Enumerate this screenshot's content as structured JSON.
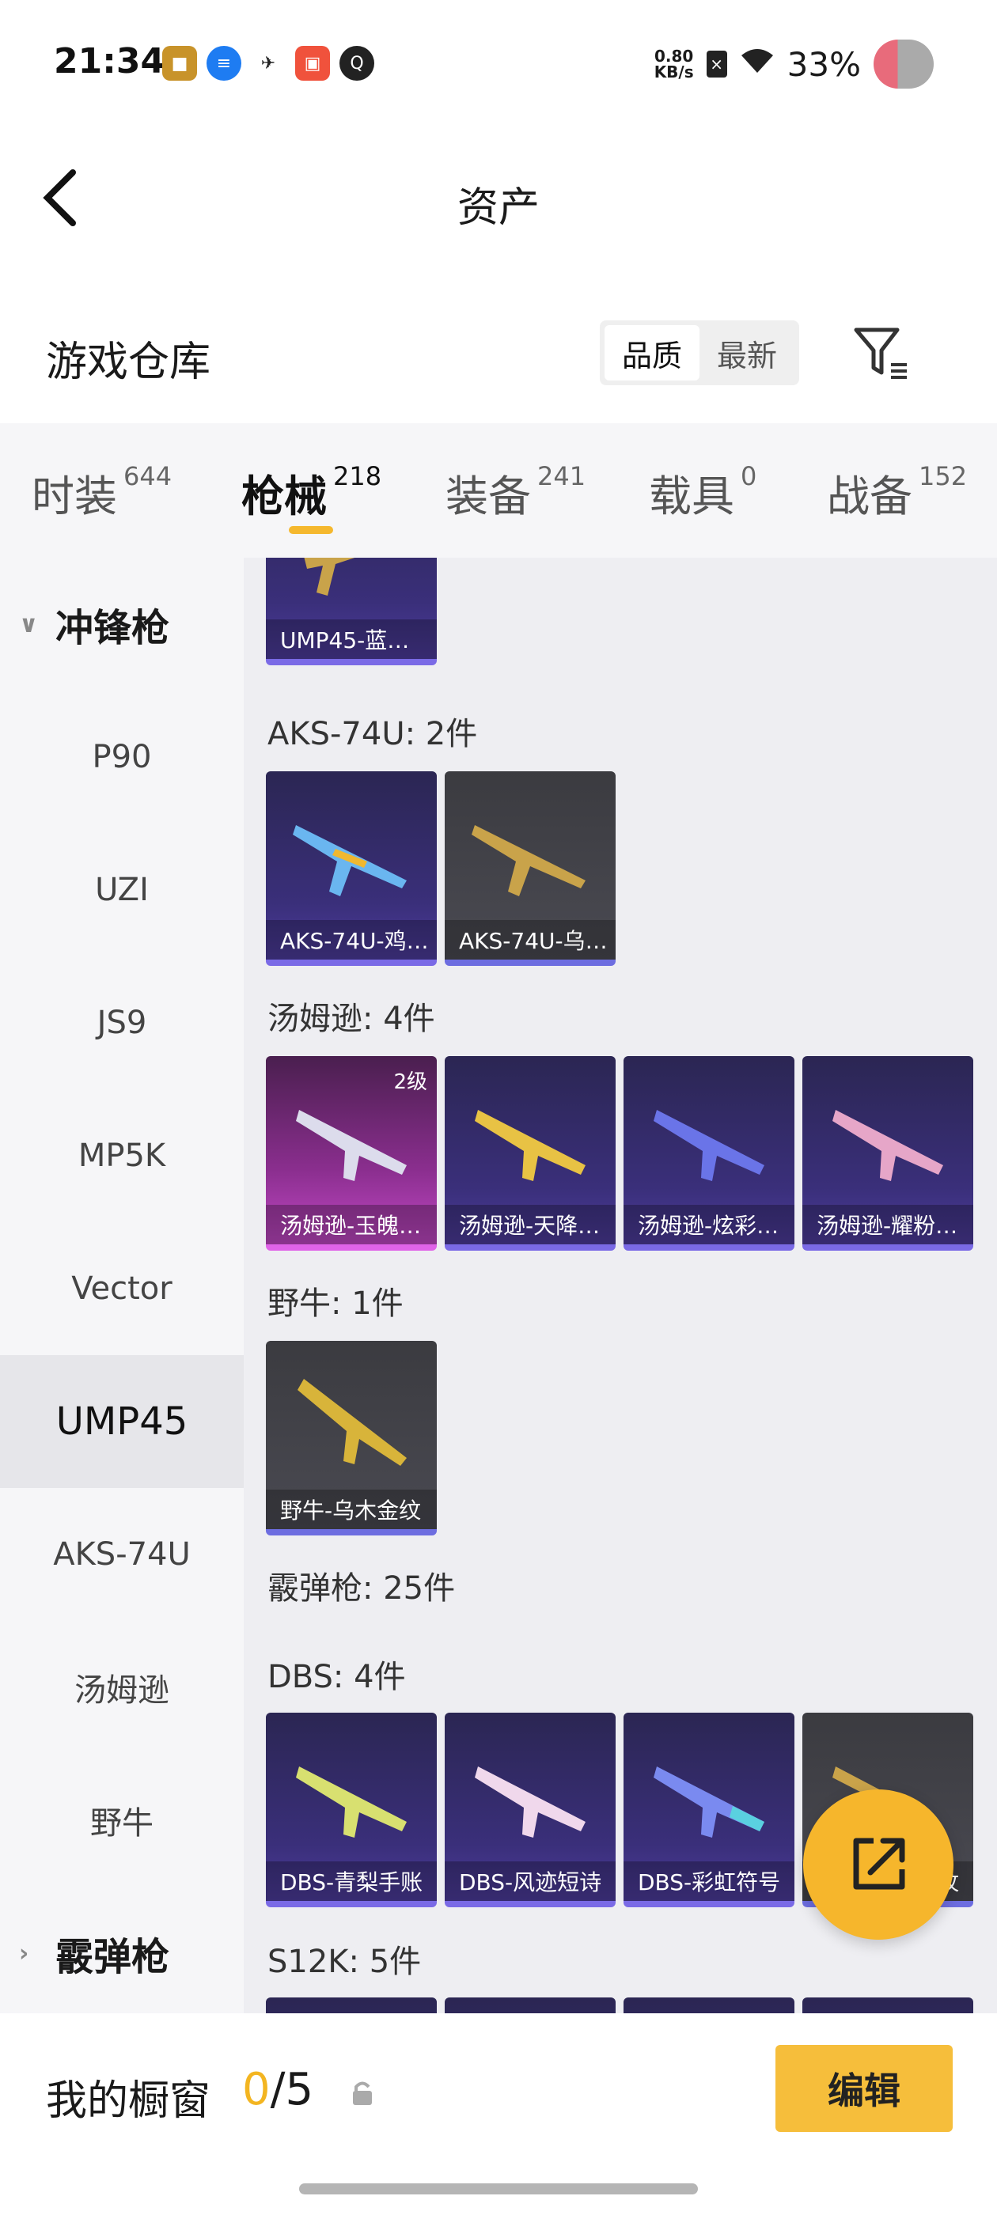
{
  "status_bar": {
    "time": "21:34",
    "net_speed_value": "0.80",
    "net_speed_unit": "KB/s",
    "battery": "33%"
  },
  "header": {
    "title": "资产"
  },
  "warehouse": {
    "title": "游戏仓库",
    "sort_options": [
      "品质",
      "最新"
    ],
    "sort_selected": "品质"
  },
  "tabs": [
    {
      "label": "时装",
      "count": "644"
    },
    {
      "label": "枪械",
      "count": "218"
    },
    {
      "label": "装备",
      "count": "241"
    },
    {
      "label": "载具",
      "count": "0"
    },
    {
      "label": "战备",
      "count": "152"
    }
  ],
  "sidebar": {
    "group_open": "冲锋枪",
    "items": [
      "P90",
      "UZI",
      "JS9",
      "MP5K",
      "Vector",
      "UMP45",
      "AKS-74U",
      "汤姆逊",
      "野牛"
    ],
    "active": "UMP45",
    "group_closed": "霰弹枪"
  },
  "content": {
    "top_card": "UMP45-蓝…",
    "sections": [
      {
        "title": "AKS-74U: 2件",
        "cards": [
          "AKS-74U-鸡…",
          "AKS-74U-乌…"
        ]
      },
      {
        "title": "汤姆逊: 4件",
        "cards": [
          "汤姆逊-玉魄…",
          "汤姆逊-天降…",
          "汤姆逊-炫彩…",
          "汤姆逊-耀粉…"
        ],
        "badge": "2级"
      },
      {
        "title": "野牛: 1件",
        "cards": [
          "野牛-乌木金纹"
        ]
      },
      {
        "title": "霰弹枪: 25件"
      },
      {
        "title": "DBS: 4件",
        "cards": [
          "DBS-青梨手账",
          "DBS-风迹短诗",
          "DBS-彩虹符号",
          "纹"
        ]
      },
      {
        "title": "S12K: 5件"
      }
    ]
  },
  "bottom_bar": {
    "label": "我的橱窗",
    "current": "0",
    "total": "/5",
    "edit": "编辑"
  },
  "colors": {
    "accent": "#f6be3b",
    "purple_card": "#3a2f7a",
    "pink_card": "#8a2e8e"
  }
}
